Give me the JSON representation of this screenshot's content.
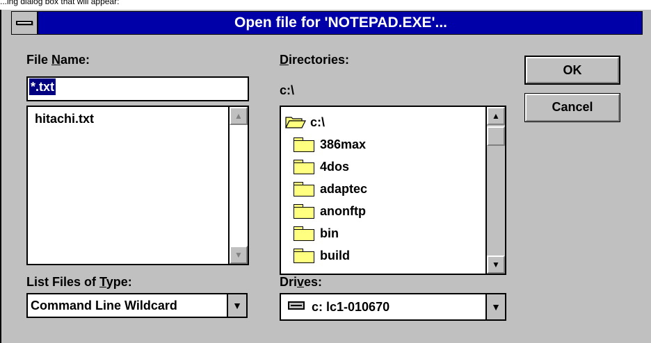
{
  "caption": "...ing dialog box that will appear:",
  "window": {
    "title": "Open file for 'NOTEPAD.EXE'..."
  },
  "file_name": {
    "label_pre": "File ",
    "label_key": "N",
    "label_post": "ame:",
    "value": "*.txt",
    "files": [
      "hitachi.txt"
    ]
  },
  "directories": {
    "label_key": "D",
    "label_post": "irectories:",
    "current_path": "c:\\",
    "items": [
      "c:\\",
      "386max",
      "4dos",
      "adaptec",
      "anonftp",
      "bin",
      "build"
    ]
  },
  "file_type": {
    "label_pre": "List Files of ",
    "label_key": "T",
    "label_post": "ype:",
    "value": "Command Line Wildcard"
  },
  "drives": {
    "label_pre": "Dri",
    "label_key": "v",
    "label_post": "es:",
    "value": "c: lc1-010670"
  },
  "buttons": {
    "ok": "OK",
    "cancel": "Cancel"
  },
  "colors": {
    "title_bar": "#0000a8",
    "face": "#c0c0c0",
    "selection": "#000080",
    "folder": "#ffff80"
  },
  "icons": {
    "system_menu": "system-menu-icon",
    "open_folder": "open-folder-icon",
    "folder": "folder-icon",
    "drive": "hard-drive-icon",
    "scroll_up": "arrow-up-icon",
    "scroll_down": "arrow-down-icon",
    "dropdown": "dropdown-arrow-icon"
  }
}
